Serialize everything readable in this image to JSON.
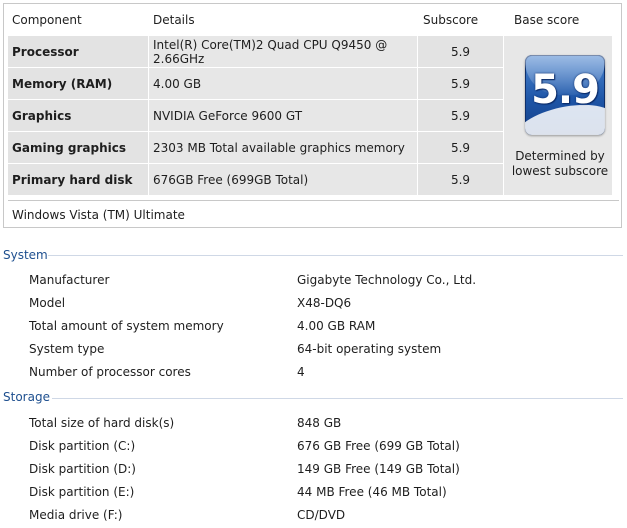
{
  "score_table": {
    "headers": {
      "component": "Component",
      "details": "Details",
      "subscore": "Subscore",
      "base_score": "Base score"
    },
    "rows": [
      {
        "component": "Processor",
        "details": "Intel(R) Core(TM)2 Quad CPU Q9450 @ 2.66GHz",
        "subscore": "5.9"
      },
      {
        "component": "Memory (RAM)",
        "details": "4.00 GB",
        "subscore": "5.9"
      },
      {
        "component": "Graphics",
        "details": "NVIDIA GeForce 9600 GT",
        "subscore": "5.9"
      },
      {
        "component": "Gaming graphics",
        "details": "2303 MB Total available graphics memory",
        "subscore": "5.9"
      },
      {
        "component": "Primary hard disk",
        "details": "676GB Free (699GB Total)",
        "subscore": "5.9"
      }
    ],
    "base_score": {
      "value": "5.9",
      "caption_line1": "Determined by",
      "caption_line2": "lowest subscore"
    },
    "os_edition": "Windows Vista (TM) Ultimate"
  },
  "system": {
    "title": "System",
    "items": [
      {
        "label": "Manufacturer",
        "value": "Gigabyte Technology Co., Ltd."
      },
      {
        "label": "Model",
        "value": "X48-DQ6"
      },
      {
        "label": "Total amount of system memory",
        "value": "4.00 GB RAM"
      },
      {
        "label": "System type",
        "value": "64-bit operating system"
      },
      {
        "label": "Number of processor cores",
        "value": "4"
      }
    ]
  },
  "storage": {
    "title": "Storage",
    "items": [
      {
        "label": "Total size of hard disk(s)",
        "value": "848 GB"
      },
      {
        "label": "Disk partition (C:)",
        "value": "676 GB Free (699 GB Total)"
      },
      {
        "label": "Disk partition (D:)",
        "value": "149 GB Free (149 GB Total)"
      },
      {
        "label": "Disk partition (E:)",
        "value": "44 MB Free (46 MB Total)"
      },
      {
        "label": "Media drive (F:)",
        "value": "CD/DVD"
      }
    ]
  },
  "colors": {
    "section_title": "#1e4f8f",
    "row_background": "#e7e7e7",
    "badge_blue": "#1e56a8"
  }
}
